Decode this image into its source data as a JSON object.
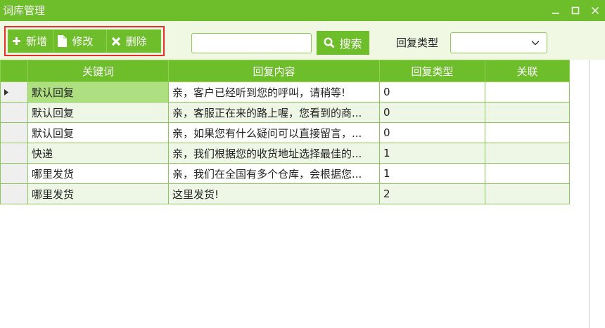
{
  "window": {
    "title": "词库管理"
  },
  "toolbar": {
    "add_label": "新增",
    "edit_label": "修改",
    "delete_label": "删除",
    "search_value": "",
    "search_placeholder": "",
    "search_label": "搜索",
    "reply_type_label": "回复类型",
    "reply_type_selected": ""
  },
  "grid": {
    "columns": [
      "关键词",
      "回复内容",
      "回复类型",
      "关联"
    ],
    "rows": [
      {
        "keyword": "默认回复",
        "content": "亲，客户已经听到您的呼叫，请稍等!",
        "type": "0",
        "link": ""
      },
      {
        "keyword": "默认回复",
        "content": "亲，客服正在来的路上喔，您看到的商...",
        "type": "0",
        "link": ""
      },
      {
        "keyword": "默认回复",
        "content": "亲，如果您有什么疑问可以直接留言，...",
        "type": "0",
        "link": ""
      },
      {
        "keyword": "快递",
        "content": "亲，我们根据您的收货地址选择最佳的...",
        "type": "1",
        "link": ""
      },
      {
        "keyword": "哪里发货",
        "content": "亲，我们在全国有多个仓库，会根据您...",
        "type": "1",
        "link": ""
      },
      {
        "keyword": "哪里发货",
        "content": "这里发货!",
        "type": "2",
        "link": ""
      }
    ],
    "selected_row": 0
  },
  "colors": {
    "accent": "#6ebd2a",
    "selection": "#aedf80",
    "alt_row": "#eef6e6",
    "highlight_border": "#e8302a"
  },
  "icons": {
    "add": "plus-icon",
    "edit": "document-icon",
    "delete": "x-icon",
    "search": "magnifier-icon",
    "dropdown": "chevron-down-icon",
    "row_pointer": "triangle-right-icon"
  }
}
